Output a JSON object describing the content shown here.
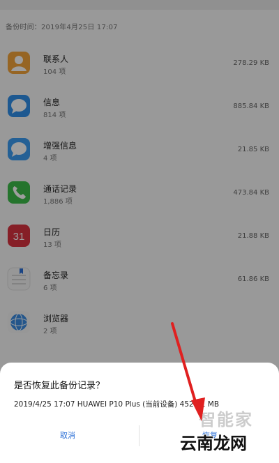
{
  "header": {
    "backup_time": "备份时间：2019年4月25日 17:07"
  },
  "items": [
    {
      "title": "联系人",
      "sub": "104 项",
      "size": "278.29 KB",
      "icon": "contacts-icon"
    },
    {
      "title": "信息",
      "sub": "814 项",
      "size": "885.84 KB",
      "icon": "messages-icon"
    },
    {
      "title": "增强信息",
      "sub": "4 项",
      "size": "21.85 KB",
      "icon": "enhanced-messages-icon"
    },
    {
      "title": "通话记录",
      "sub": "1,886 项",
      "size": "473.84 KB",
      "icon": "phone-icon"
    },
    {
      "title": "日历",
      "sub": "13 项",
      "size": "21.88 KB",
      "icon": "calendar-icon",
      "icon_text": "31"
    },
    {
      "title": "备忘录",
      "sub": "6 项",
      "size": "61.86 KB",
      "icon": "notes-icon"
    },
    {
      "title": "浏览器",
      "sub": "2 项",
      "size": "",
      "icon": "browser-icon"
    }
  ],
  "dialog": {
    "question": "是否恢复此备份记录？",
    "detail": "2019/4/25 17:07  HUAWEI P10 Plus (当前设备) 452.71 MB",
    "cancel_label": "取消",
    "confirm_label": "恢复"
  },
  "watermarks": {
    "top": "智能家",
    "bottom": "云南龙网"
  },
  "colors": {
    "accent": "#2b6fd6",
    "arrow": "#e02020"
  }
}
